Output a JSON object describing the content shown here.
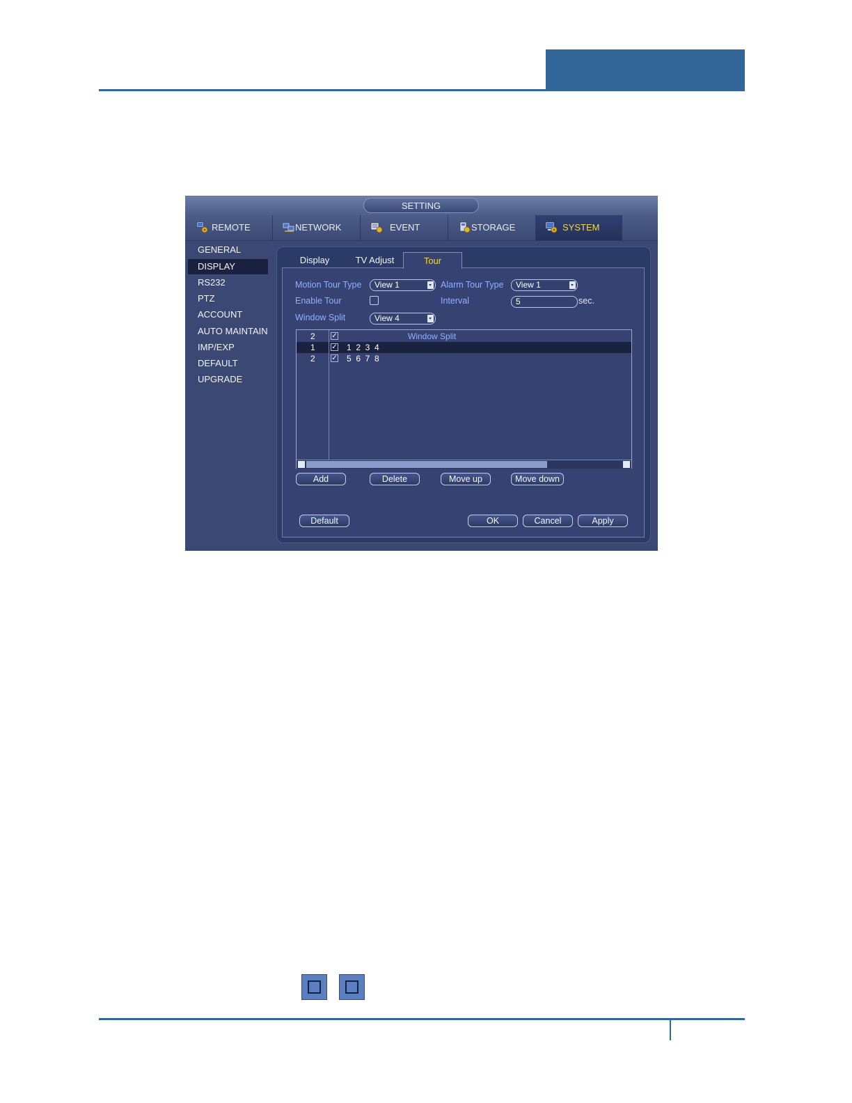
{
  "window": {
    "title": "SETTING"
  },
  "main_tabs": [
    {
      "label": "REMOTE",
      "icon": "remote-icon"
    },
    {
      "label": "NETWORK",
      "icon": "network-icon"
    },
    {
      "label": "EVENT",
      "icon": "event-icon"
    },
    {
      "label": "STORAGE",
      "icon": "storage-icon"
    },
    {
      "label": "SYSTEM",
      "icon": "system-icon",
      "selected": true
    }
  ],
  "sidebar": {
    "items": [
      "GENERAL",
      "DISPLAY",
      "RS232",
      "PTZ",
      "ACCOUNT",
      "AUTO MAINTAIN",
      "IMP/EXP",
      "DEFAULT",
      "UPGRADE"
    ],
    "selected": "DISPLAY"
  },
  "sub_tabs": [
    {
      "label": "Display"
    },
    {
      "label": "TV Adjust"
    },
    {
      "label": "Tour",
      "selected": true
    }
  ],
  "form": {
    "motion_tour_type_label": "Motion Tour Type",
    "motion_tour_type_value": "View 1",
    "alarm_tour_type_label": "Alarm Tour Type",
    "alarm_tour_type_value": "View 1",
    "enable_tour_label": "Enable Tour",
    "enable_tour_checked": false,
    "interval_label": "Interval",
    "interval_value": "5",
    "interval_unit": "sec.",
    "window_split_label": "Window Split",
    "window_split_value": "View 4"
  },
  "table": {
    "header": {
      "count": "2",
      "title": "Window Split"
    },
    "rows": [
      {
        "index": "1",
        "channels": "1  2  3  4",
        "checked": true,
        "selected": true
      },
      {
        "index": "2",
        "channels": "5  6  7  8",
        "checked": true,
        "selected": false
      }
    ]
  },
  "buttons": {
    "add": "Add",
    "delete": "Delete",
    "move_up": "Move up",
    "move_down": "Move down",
    "default": "Default",
    "ok": "OK",
    "cancel": "Cancel",
    "apply": "Apply"
  },
  "colors": {
    "brand_blue": "#336699",
    "selected_tab_text": "#f1d84a",
    "label_blue": "#8fb0ff"
  },
  "page_icons": [
    "rotate-icon",
    "screen-icon"
  ]
}
